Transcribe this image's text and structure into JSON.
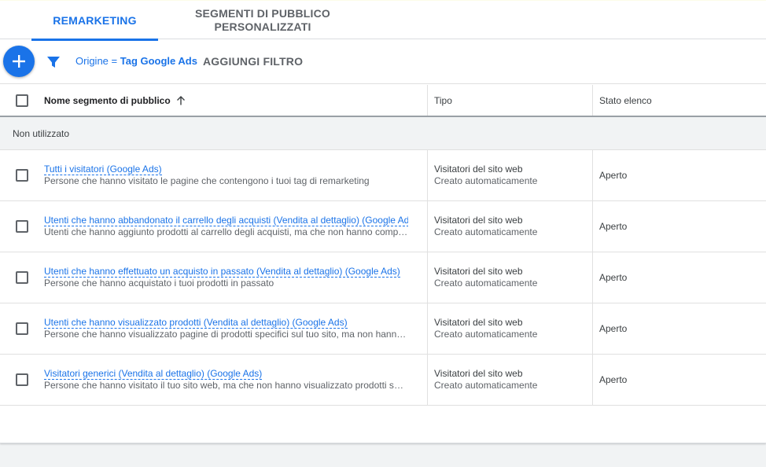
{
  "tabs": {
    "remarketing": "REMARKETING",
    "custom_segments": "SEGMENTI DI PUBBLICO\nPERSONALIZZATI"
  },
  "toolbar": {
    "add_icon": "plus-icon",
    "filter_icon": "filter-icon",
    "filter_field": "Origine = ",
    "filter_value": "Tag Google Ads",
    "add_filter_label": "AGGIUNGI FILTRO"
  },
  "table": {
    "headers": {
      "name": "Nome segmento di pubblico",
      "type": "Tipo",
      "state": "Stato elenco"
    },
    "sort_icon": "arrow-up-icon",
    "group_label": "Non utilizzato",
    "rows": [
      {
        "name": "Tutti i visitatori (Google Ads)",
        "description": "Persone che hanno visitato le pagine che contengono i tuoi tag di remarketing",
        "type": "Visitatori del sito web",
        "type_sub": "Creato automaticamente",
        "state": "Aperto"
      },
      {
        "name": "Utenti che hanno abbandonato il carrello degli acquisti (Vendita al dettaglio) (Google Ads)",
        "description": "Utenti che hanno aggiunto prodotti al carrello degli acquisti, ma che non hanno completato l'acquisto",
        "type": "Visitatori del sito web",
        "type_sub": "Creato automaticamente",
        "state": "Aperto"
      },
      {
        "name": "Utenti che hanno effettuato un acquisto in passato (Vendita al dettaglio) (Google Ads)",
        "description": "Persone che hanno acquistato i tuoi prodotti in passato",
        "type": "Visitatori del sito web",
        "type_sub": "Creato automaticamente",
        "state": "Aperto"
      },
      {
        "name": "Utenti che hanno visualizzato prodotti (Vendita al dettaglio) (Google Ads)",
        "description": "Persone che hanno visualizzato pagine di prodotti specifici sul tuo sito, ma non hanno effettuato acquisti",
        "type": "Visitatori del sito web",
        "type_sub": "Creato automaticamente",
        "state": "Aperto"
      },
      {
        "name": "Visitatori generici (Vendita al dettaglio) (Google Ads)",
        "description": "Persone che hanno visitato il tuo sito web, ma che non hanno visualizzato prodotti specifici",
        "type": "Visitatori del sito web",
        "type_sub": "Creato automaticamente",
        "state": "Aperto"
      }
    ]
  },
  "colors": {
    "accent": "#1a73e8",
    "muted_text": "#5f6368",
    "group_background": "#f1f3f4"
  }
}
